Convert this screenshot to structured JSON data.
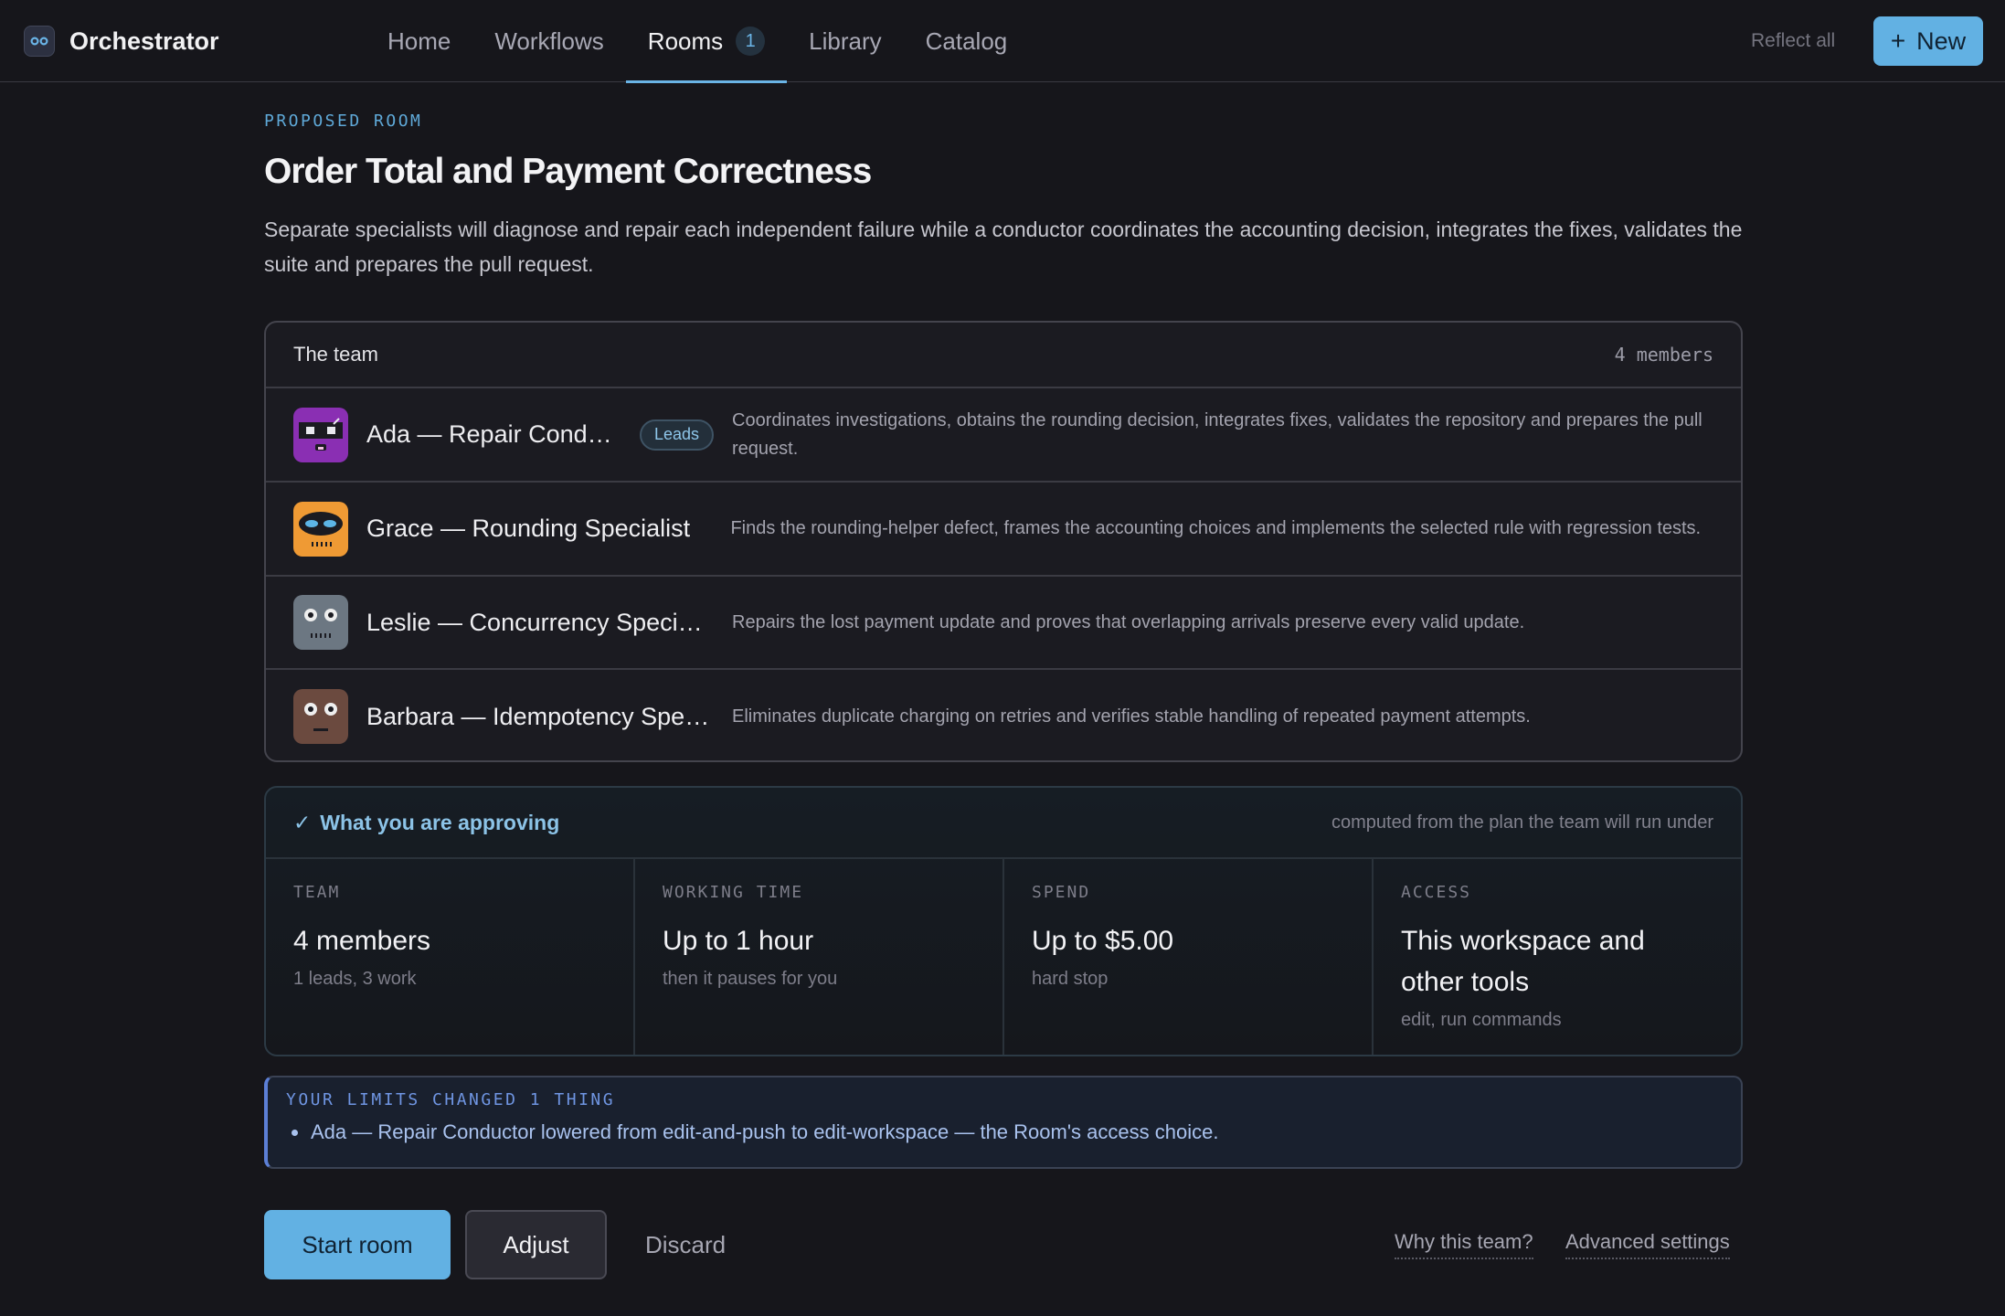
{
  "app": {
    "name": "Orchestrator"
  },
  "nav": {
    "items": [
      {
        "label": "Home"
      },
      {
        "label": "Workflows"
      },
      {
        "label": "Rooms",
        "badge": "1",
        "active": true
      },
      {
        "label": "Library"
      },
      {
        "label": "Catalog"
      }
    ],
    "reflect_label": "Reflect all",
    "new_label": "New"
  },
  "room": {
    "eyebrow": "PROPOSED ROOM",
    "title": "Order Total and Payment Correctness",
    "description": "Separate specialists will diagnose and repair each independent failure while a conductor coordinates the accounting decision, integrates the fixes, validates the suite and prepares the pull request."
  },
  "team": {
    "title": "The team",
    "count": "4 members",
    "members": [
      {
        "name": "Ada — Repair Conduc...",
        "badge": "Leads",
        "description": "Coordinates investigations, obtains the rounding decision, integrates fixes, validates the repository and prepares the pull request.",
        "avatar_icon": "robot-purple-icon",
        "avatar_color": "#8a2fb3"
      },
      {
        "name": "Grace — Rounding Specialist",
        "description": "Finds the rounding-helper defect, frames the accounting choices and implements the selected rule with regression tests.",
        "avatar_icon": "robot-orange-icon",
        "avatar_color": "#ef9a34"
      },
      {
        "name": "Leslie — Concurrency Special...",
        "description": "Repairs the lost payment update and proves that overlapping arrivals preserve every valid update.",
        "avatar_icon": "robot-gray-icon",
        "avatar_color": "#6c7782"
      },
      {
        "name": "Barbara — Idempotency Spec...",
        "description": "Eliminates duplicate charging on retries and verifies stable handling of repeated payment attempts.",
        "avatar_icon": "robot-brown-icon",
        "avatar_color": "#6b4a3f"
      }
    ]
  },
  "approving": {
    "title": "What you are approving",
    "note": "computed from the plan the team will run under",
    "cells": [
      {
        "label": "TEAM",
        "value": "4 members",
        "sub": "1 leads, 3 work"
      },
      {
        "label": "WORKING TIME",
        "value": "Up to 1 hour",
        "sub": "then it pauses for you"
      },
      {
        "label": "SPEND",
        "value": "Up to $5.00",
        "sub": "hard stop"
      },
      {
        "label": "ACCESS",
        "value": "This workspace and other tools",
        "sub": "edit, run commands"
      }
    ]
  },
  "limits": {
    "label": "YOUR LIMITS CHANGED 1 THING",
    "items": [
      "Ada — Repair Conductor lowered from edit-and-push to edit-workspace — the Room's access choice."
    ]
  },
  "actions": {
    "start": "Start room",
    "adjust": "Adjust",
    "discard": "Discard",
    "why": "Why this team?",
    "advanced": "Advanced settings"
  },
  "colors": {
    "accent": "#62b1e3",
    "background": "#16161b",
    "limits_accent": "#5c7fd6"
  }
}
